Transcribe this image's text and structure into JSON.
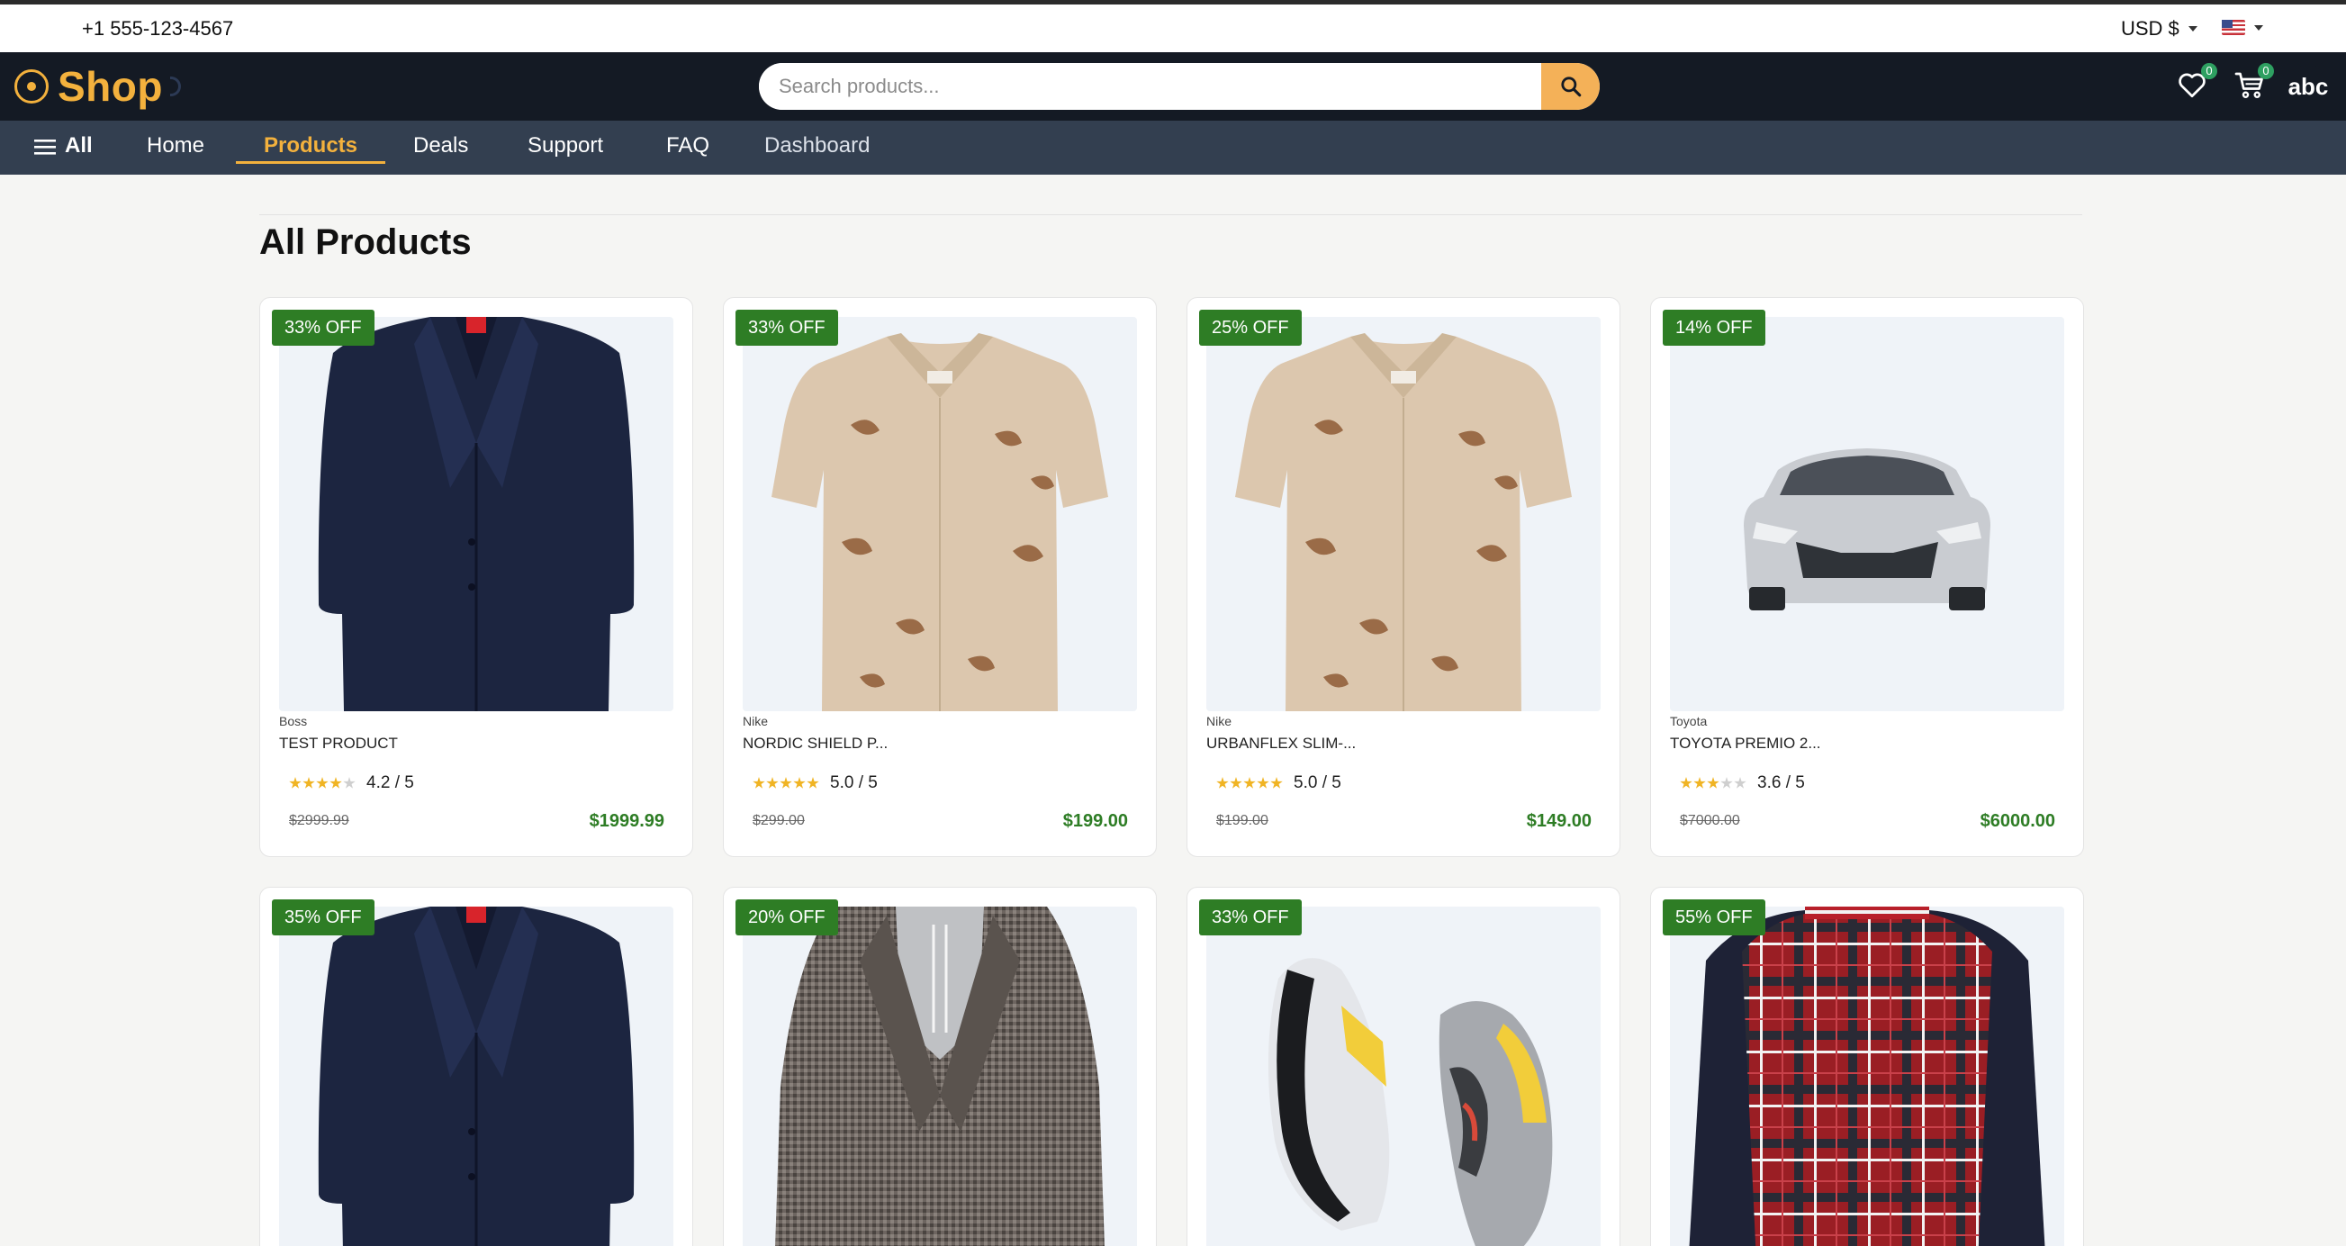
{
  "topbar": {
    "phone": "+1 555-123-4567",
    "currency": "USD $"
  },
  "header": {
    "logo": "Shop",
    "search_placeholder": "Search products...",
    "wishlist_count": "0",
    "cart_count": "0",
    "avatar": "abc"
  },
  "nav": {
    "all": "All",
    "items": [
      "Home",
      "Products",
      "Deals",
      "Support",
      "FAQ",
      "Dashboard"
    ],
    "active": "Products"
  },
  "page_title": "All Products",
  "products": [
    {
      "discount": "33% OFF",
      "brand": "Boss",
      "name": "TEST PRODUCT",
      "rating": "4.2 / 5",
      "stars": 4,
      "old_price": "$2999.99",
      "price": "$1999.99",
      "image": "suit"
    },
    {
      "discount": "33% OFF",
      "brand": "Nike",
      "name": "NORDIC SHIELD P...",
      "rating": "5.0 / 5",
      "stars": 5,
      "old_price": "$299.00",
      "price": "$199.00",
      "image": "shirt"
    },
    {
      "discount": "25% OFF",
      "brand": "Nike",
      "name": "URBANFLEX SLIM-...",
      "rating": "5.0 / 5",
      "stars": 5,
      "old_price": "$199.00",
      "price": "$149.00",
      "image": "shirt"
    },
    {
      "discount": "14% OFF",
      "brand": "Toyota",
      "name": "TOYOTA PREMIO 2...",
      "rating": "3.6 / 5",
      "stars": 3,
      "old_price": "$7000.00",
      "price": "$6000.00",
      "image": "car"
    },
    {
      "discount": "35% OFF",
      "image": "suit"
    },
    {
      "discount": "20% OFF",
      "image": "coat"
    },
    {
      "discount": "33% OFF",
      "image": "shoes"
    },
    {
      "discount": "55% OFF",
      "image": "plaid-jacket"
    }
  ]
}
